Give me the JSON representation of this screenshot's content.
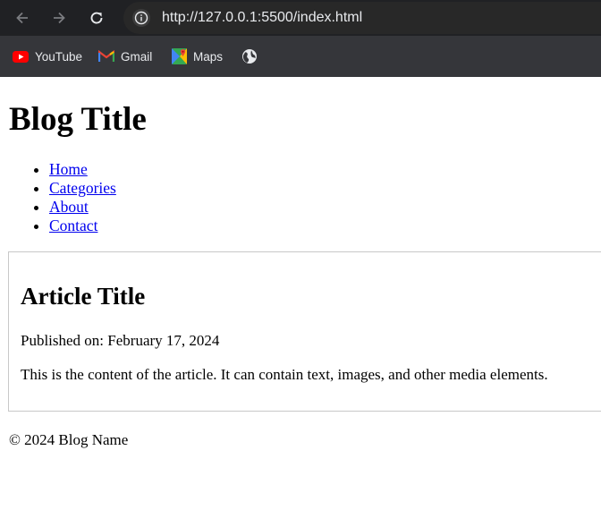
{
  "browser": {
    "url": "http://127.0.0.1:5500/index.html",
    "bookmarks": [
      {
        "label": "YouTube",
        "icon": "youtube-icon"
      },
      {
        "label": "Gmail",
        "icon": "gmail-icon"
      },
      {
        "label": "Maps",
        "icon": "maps-icon"
      },
      {
        "label": "",
        "icon": "globe-icon"
      }
    ]
  },
  "page": {
    "blog_title": "Blog Title",
    "nav": [
      "Home",
      "Categories",
      "About",
      "Contact"
    ],
    "article": {
      "title": "Article Title",
      "published": "Published on: February 17, 2024",
      "content": "This is the content of the article. It can contain text, images, and other media elements."
    },
    "footer": "© 2024 Blog Name"
  },
  "colors": {
    "toolbar": "#202124",
    "bookmarks_bar": "#35363a",
    "link": "#0000ee"
  }
}
